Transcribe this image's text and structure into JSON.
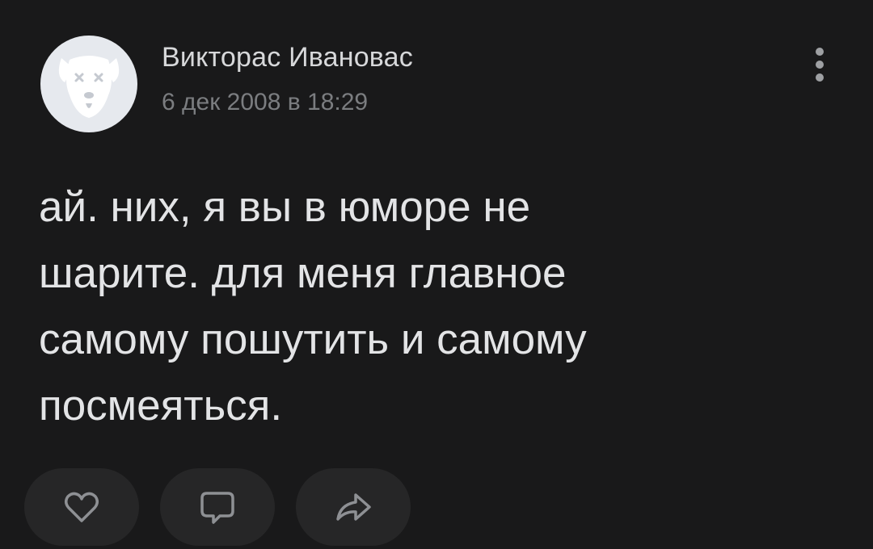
{
  "post": {
    "author": {
      "name": "Викторас Ивановас",
      "avatar_icon": "dog-avatar-icon"
    },
    "date": "6 дек 2008 в 18:29",
    "menu_icon": "more-vertical-icon",
    "text": "ай. них, я вы в юморе не\nшарите. для меня главное\nсамому пошутить и самому\nпосмеяться.",
    "actions": [
      {
        "name": "like-button",
        "icon": "heart-icon"
      },
      {
        "name": "comment-button",
        "icon": "comment-icon"
      },
      {
        "name": "share-button",
        "icon": "share-icon"
      }
    ]
  },
  "colors": {
    "background": "#19191a",
    "text": "#e3e4e6",
    "muted": "#7b7d80",
    "button": "#262627",
    "avatar_bg": "#e6e9ee"
  }
}
